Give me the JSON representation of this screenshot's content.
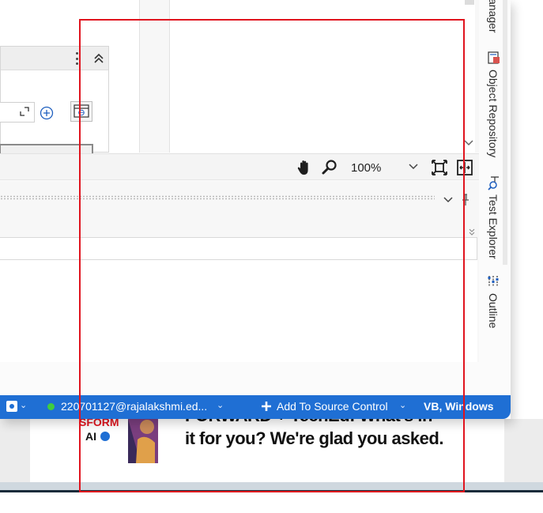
{
  "side_tabs": {
    "manager_label": "anager",
    "object_repository_label": "Object Repository",
    "test_explorer_label": "Test Explorer",
    "outline_label": "Outline"
  },
  "zoom_toolbar": {
    "zoom_value": "100%"
  },
  "status_bar": {
    "account": "220701127@rajalakshmi.ed...",
    "add_to_source_control": "Add To Source Control",
    "language": "VB, Windows",
    "caret": "⌄",
    "online_color": "#3fcd3f",
    "bar_color": "#1f6fd4"
  },
  "background_ad": {
    "logo_line1": "SFORM",
    "logo_line2": "AI",
    "headline_line1": "FORWARD + TechEd: What's in",
    "headline_line2": "it for you? We're glad you asked."
  },
  "overlay": {
    "capture_color": "#e0141e"
  }
}
